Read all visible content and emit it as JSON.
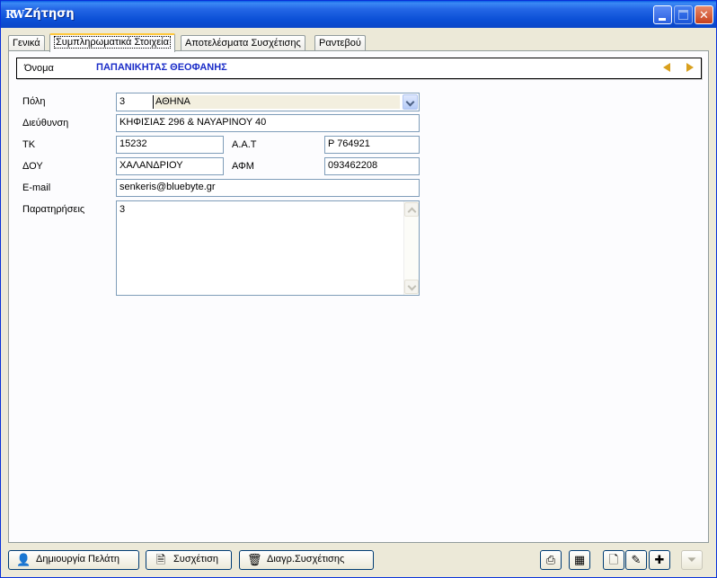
{
  "window": {
    "title": "Ζήτηση",
    "app_icon_text": "RW"
  },
  "tabs": [
    {
      "label": "Γενικά"
    },
    {
      "label": "Συμπληρωματικά Στοιχεία"
    },
    {
      "label": "Αποτελέσματα Συσχέτισης"
    },
    {
      "label": "Ραντεβού"
    }
  ],
  "active_tab": "Συμπληρωματικά Στοιχεία",
  "header": {
    "name_label": "Όνομα",
    "name_value": "ΠΑΠΑΝΙΚΗΤΑΣ ΘΕΟΦΑΝΗΣ"
  },
  "form": {
    "city_label": "Πόλη",
    "city_code": "3",
    "city_name": "ΑΘΗΝΑ",
    "address_label": "Διεύθυνση",
    "address_value": "ΚΗΦΙΣΙΑΣ 296 & ΝΑΥΑΡΙΝΟΥ 40",
    "tk_label": "ΤΚ",
    "tk_value": "15232",
    "aat_label": "Α.Α.Τ",
    "aat_value": "Ρ 764921",
    "doy_label": "ΔΟΥ",
    "doy_value": "ΧΑΛΑΝΔΡΙΟΥ",
    "afm_label": "ΑΦΜ",
    "afm_value": "093462208",
    "email_label": "E-mail",
    "email_value": "senkeris@bluebyte.gr",
    "notes_label": "Παρατηρήσεις",
    "notes_value": "3"
  },
  "buttons": {
    "create_client": "Δημιουργία Πελάτη",
    "correlate": "Συσχέτιση",
    "delete_correlation": "Διαγρ.Συσχέτισης"
  },
  "icons": {
    "create_client": "add-user-icon",
    "correlate": "link-icon",
    "delete_correlation": "delete-icon",
    "print": "printer-icon",
    "grid": "grid-icon",
    "document": "document-icon",
    "edit": "pen-icon",
    "add_tool": "add-tool-icon",
    "filter": "filter-icon"
  },
  "colors": {
    "name_value": "#1a2cc8",
    "title_bar": "#0a4fd6",
    "nav_arrow": "#d9a01e"
  }
}
